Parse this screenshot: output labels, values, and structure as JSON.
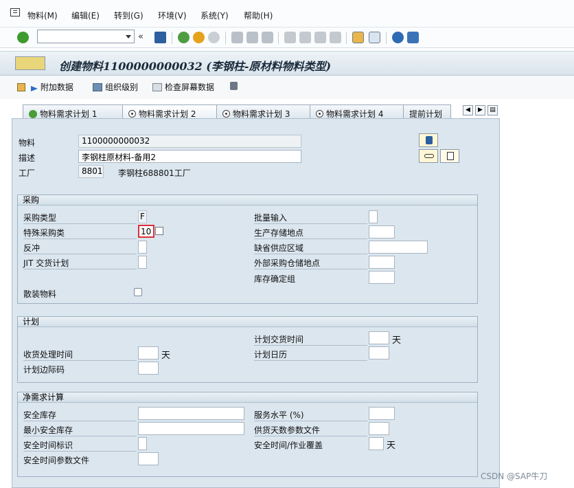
{
  "menu": {
    "items": [
      "物料(M)",
      "编辑(E)",
      "转到(G)",
      "环境(V)",
      "系统(Y)",
      "帮助(H)"
    ]
  },
  "toolbar": {
    "command_field_value": "",
    "icons": [
      "enter-icon",
      "back-icon",
      "save-icon",
      "back-nav-icon",
      "exit-icon",
      "cancel-icon",
      "print-icon",
      "find-icon",
      "find-next-icon",
      "first-page-icon",
      "prev-page-icon",
      "next-page-icon",
      "last-page-icon",
      "new-session-icon",
      "shortcut-icon",
      "help-icon",
      "customize-layout-icon"
    ]
  },
  "title": "创建物料1100000000032 (李钢柱-原材料物料类型)",
  "app_toolbar": {
    "additional_data": "附加数据",
    "org_levels": "组织级别",
    "check_screen_data": "检查屏幕数据"
  },
  "tabs": [
    {
      "label": "物料需求计划 1",
      "active": false,
      "icon": "checkmark-icon"
    },
    {
      "label": "物料需求计划 2",
      "active": true,
      "icon": "radio-icon"
    },
    {
      "label": "物料需求计划 3",
      "active": false,
      "icon": "radio-icon"
    },
    {
      "label": "物料需求计划 4",
      "active": false,
      "icon": "radio-icon"
    },
    {
      "label": "提前计划",
      "active": false,
      "icon": ""
    }
  ],
  "header": {
    "material_label": "物料",
    "material_value": "1100000000032",
    "description_label": "描述",
    "description_value": "李钢柱原材料-备用2",
    "plant_label": "工厂",
    "plant_value": "8801",
    "plant_name": "李钢柱688801工厂"
  },
  "procurement": {
    "title": "采购",
    "proc_type_label": "采购类型",
    "proc_type_value": "F",
    "special_proc_label": "特殊采购类",
    "special_proc_value": "10",
    "backflush_label": "反冲",
    "jit_label": "JIT 交货计划",
    "bulk_material_label": "散装物料",
    "batch_entry_label": "批量输入",
    "prod_storage_label": "生产存储地点",
    "default_supply_area_label": "缺省供应区域",
    "ext_proc_storage_label": "外部采购仓储地点",
    "stock_det_group_label": "库存确定组"
  },
  "scheduling": {
    "title": "计划",
    "gr_proc_time_label": "收货处理时间",
    "gr_unit": "天",
    "sched_margin_label": "计划边际码",
    "planned_deliv_label": "计划交货时间",
    "planned_deliv_unit": "天",
    "planning_cal_label": "计划日历"
  },
  "net_requirements": {
    "title": "净需求计算",
    "safety_stock_label": "安全库存",
    "min_safety_stock_label": "最小安全库存",
    "safety_time_ind_label": "安全时间标识",
    "safety_time_profile_label": "安全时间参数文件",
    "service_level_label": "服务水平 (%)",
    "coverage_profile_label": "供货天数参数文件",
    "safety_time_label": "安全时间/作业覆盖",
    "safety_time_unit": "天"
  },
  "watermark": "CSDN @SAP牛刀"
}
